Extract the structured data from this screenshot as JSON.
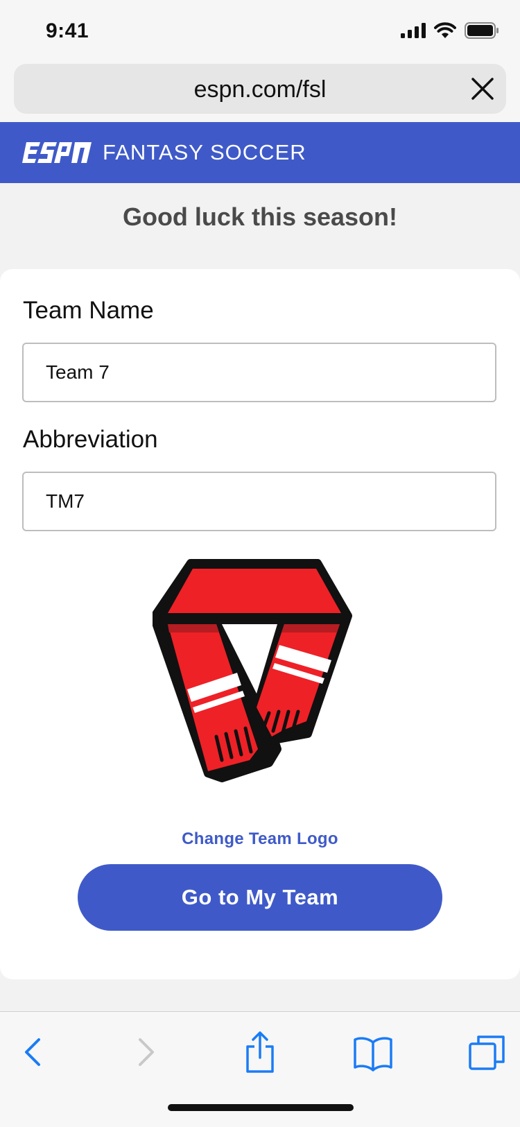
{
  "status": {
    "time": "9:41"
  },
  "browser": {
    "url": "espn.com/fsl"
  },
  "header": {
    "brand": "ESPN",
    "title": "FANTASY SOCCER",
    "color": "#3f5ac8"
  },
  "greeting": "Good luck this season!",
  "form": {
    "team_name_label": "Team Name",
    "team_name_value": "Team 7",
    "abbreviation_label": "Abbreviation",
    "abbreviation_value": "TM7"
  },
  "logo": {
    "icon": "red-scarf-team-logo",
    "color": "#ee2127"
  },
  "change_logo_label": "Change Team Logo",
  "primary_button_label": "Go to My Team",
  "toolbar": {
    "items": [
      "back-icon",
      "forward-icon",
      "share-icon",
      "bookmarks-icon",
      "tabs-icon"
    ]
  }
}
